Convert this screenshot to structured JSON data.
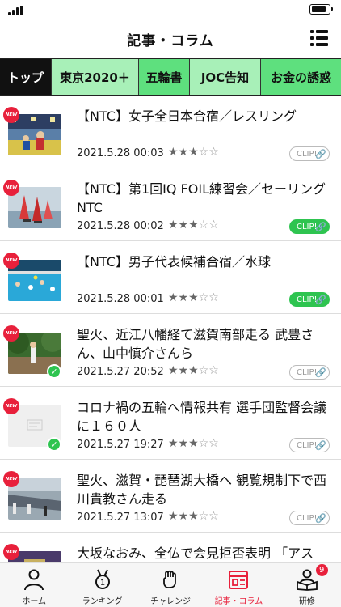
{
  "header": {
    "title": "記事・コラム",
    "menu_icon": "list-menu-icon"
  },
  "tabs": [
    {
      "label": "トップ",
      "active": true
    },
    {
      "label": "東京2020＋",
      "active": false
    },
    {
      "label": "五輪書",
      "active": false
    },
    {
      "label": "JOC告知",
      "active": false
    },
    {
      "label": "お金の誘惑",
      "active": false
    }
  ],
  "articles": [
    {
      "badge": "NEW",
      "title": "【NTC】女子全日本合宿／レスリング",
      "date": "2021.5.28 00:03",
      "rating": 3,
      "max_rating": 5,
      "clip_label": "CLIP!",
      "clipped": false,
      "read": false
    },
    {
      "badge": "NEW",
      "title": "【NTC】第1回IQ FOIL練習会／セーリングNTC",
      "date": "2021.5.28 00:02",
      "rating": 3,
      "max_rating": 5,
      "clip_label": "CLIP!",
      "clipped": true,
      "read": false
    },
    {
      "badge": "NEW",
      "title": "【NTC】男子代表候補合宿／水球",
      "date": "2021.5.28 00:01",
      "rating": 3,
      "max_rating": 5,
      "clip_label": "CLIP!",
      "clipped": true,
      "read": false
    },
    {
      "badge": "NEW",
      "title": "聖火、近江八幡経て滋賀南部走る 武豊さん、山中慎介さんら",
      "date": "2021.5.27 20:52",
      "rating": 3,
      "max_rating": 5,
      "clip_label": "CLIP!",
      "clipped": false,
      "read": true
    },
    {
      "badge": "NEW",
      "title": "コロナ禍の五輪へ情報共有 選手団監督会議に１６０人",
      "date": "2021.5.27 19:27",
      "rating": 3,
      "max_rating": 5,
      "clip_label": "CLIP!",
      "clipped": false,
      "read": true
    },
    {
      "badge": "NEW",
      "title": "聖火、滋賀・琵琶湖大橋へ 観覧規制下で西川貴教さん走る",
      "date": "2021.5.27 13:07",
      "rating": 3,
      "max_rating": 5,
      "clip_label": "CLIP!",
      "clipped": false,
      "read": false
    },
    {
      "badge": "NEW",
      "title": "大坂なおみ、全仏で会見拒否表明 「アス",
      "date": "",
      "rating": 0,
      "max_rating": 5,
      "clip_label": "",
      "clipped": false,
      "read": false
    }
  ],
  "bottom_nav": [
    {
      "label": "ホーム",
      "icon": "person-icon",
      "active": false,
      "badge": ""
    },
    {
      "label": "ランキング",
      "icon": "medal-icon",
      "active": false,
      "badge": ""
    },
    {
      "label": "チャレンジ",
      "icon": "fist-icon",
      "active": false,
      "badge": ""
    },
    {
      "label": "記事・コラム",
      "icon": "article-icon",
      "active": true,
      "badge": ""
    },
    {
      "label": "研修",
      "icon": "study-icon",
      "active": false,
      "badge": "9"
    }
  ],
  "colors": {
    "accent_red": "#e8203b",
    "tab_green_light": "#a8f0b8",
    "tab_green_bright": "#5ee07e",
    "clip_green": "#2ec450"
  }
}
